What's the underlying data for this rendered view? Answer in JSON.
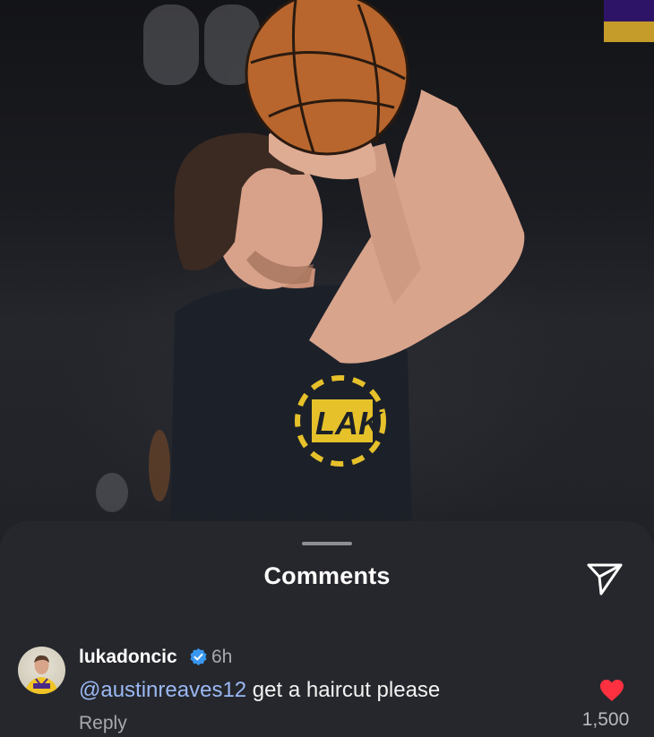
{
  "sheet": {
    "title": "Comments",
    "share_icon": "paper-plane-icon"
  },
  "comment": {
    "username": "lukadoncic",
    "verified_icon": "verified-badge-icon",
    "time": "6h",
    "mention": "@austinreaves12",
    "text": " get a haircut please",
    "reply_label": "Reply",
    "like_icon": "heart-icon",
    "like_count": "1,500"
  },
  "photo": {
    "jersey_text": "LAK"
  },
  "colors": {
    "sheet_background": "#26272c",
    "mention": "#9ab8f4",
    "heart": "#ff3040",
    "verified": "#3897f0"
  }
}
